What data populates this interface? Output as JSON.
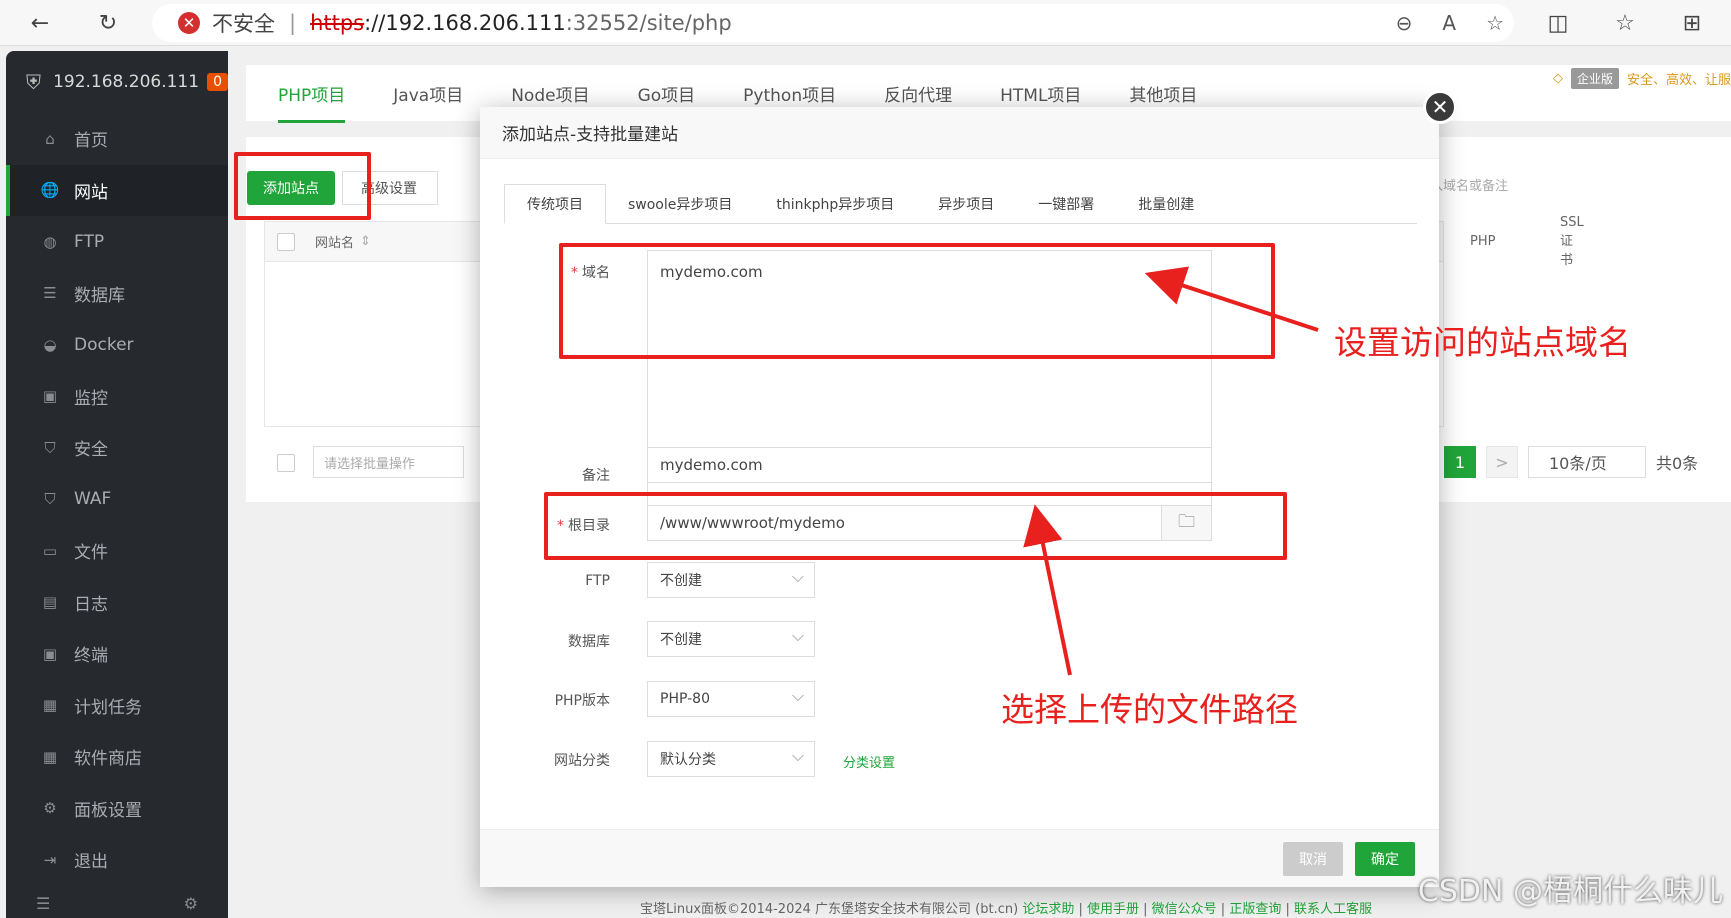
{
  "browser": {
    "security_label": "不安全",
    "url_scheme": "https",
    "url_host": "://192.168.206.111",
    "url_rest": ":32552/site/php"
  },
  "sidebar": {
    "server": "192.168.206.111",
    "badge": "0",
    "items": [
      {
        "label": "首页",
        "icon": "home-icon",
        "glyph": "⌂"
      },
      {
        "label": "网站",
        "icon": "globe-icon",
        "glyph": "🌐",
        "active": true
      },
      {
        "label": "FTP",
        "icon": "ftp-icon",
        "glyph": "◍"
      },
      {
        "label": "数据库",
        "icon": "database-icon",
        "glyph": "☰"
      },
      {
        "label": "Docker",
        "icon": "docker-icon",
        "glyph": "◒"
      },
      {
        "label": "监控",
        "icon": "monitor-icon",
        "glyph": "▣"
      },
      {
        "label": "安全",
        "icon": "shield-icon",
        "glyph": "⛉"
      },
      {
        "label": "WAF",
        "icon": "waf-icon",
        "glyph": "⛉"
      },
      {
        "label": "文件",
        "icon": "folder-icon",
        "glyph": "▭"
      },
      {
        "label": "日志",
        "icon": "log-icon",
        "glyph": "▤"
      },
      {
        "label": "终端",
        "icon": "terminal-icon",
        "glyph": "▣"
      },
      {
        "label": "计划任务",
        "icon": "calendar-icon",
        "glyph": "▦"
      },
      {
        "label": "软件商店",
        "icon": "store-icon",
        "glyph": "▦"
      },
      {
        "label": "面板设置",
        "icon": "gear-icon",
        "glyph": "⚙"
      },
      {
        "label": "退出",
        "icon": "logout-icon",
        "glyph": "⇥"
      }
    ]
  },
  "tabs": [
    "PHP项目",
    "Java项目",
    "Node项目",
    "Go项目",
    "Python项目",
    "反向代理",
    "HTML项目",
    "其他项目"
  ],
  "promo": {
    "badge": "企业版",
    "text": "安全、高效、让服"
  },
  "toolbar": {
    "add_site": "添加站点",
    "advanced": "高级设置",
    "search_placeholder": "入域名或备注"
  },
  "table": {
    "col_name": "网站名",
    "col_php": "PHP",
    "col_ssl": "SSL证书"
  },
  "batch_placeholder": "请选择批量操作",
  "pager": {
    "page": "1",
    "next": ">",
    "page_size": "10条/页",
    "total": "共0条"
  },
  "footer": {
    "copyright": "宝塔Linux面板©2014-2024 广东堡塔安全技术有限公司 (bt.cn)",
    "links": [
      "论坛求助",
      "使用手册",
      "微信公众号",
      "正版查询",
      "联系人工客服"
    ]
  },
  "modal": {
    "title": "添加站点-支持批量建站",
    "tabs": [
      "传统项目",
      "swoole异步项目",
      "thinkphp异步项目",
      "异步项目",
      "一键部署",
      "批量创建"
    ],
    "domain_label": "域名",
    "domain_value": "mydemo.com",
    "remark_label": "备注",
    "remark_value": "mydemo.com",
    "root_label": "根目录",
    "root_value": "/www/wwwroot/mydemo",
    "ftp_label": "FTP",
    "ftp_value": "不创建",
    "db_label": "数据库",
    "db_value": "不创建",
    "php_label": "PHP版本",
    "php_value": "PHP-80",
    "category_label": "网站分类",
    "category_value": "默认分类",
    "category_link": "分类设置",
    "cancel": "取消",
    "ok": "确定"
  },
  "annotations": {
    "domain_note": "设置访问的站点域名",
    "path_note": "选择上传的文件路径",
    "color": "#e8201e"
  },
  "watermark": "CSDN @梧桐什么味儿"
}
